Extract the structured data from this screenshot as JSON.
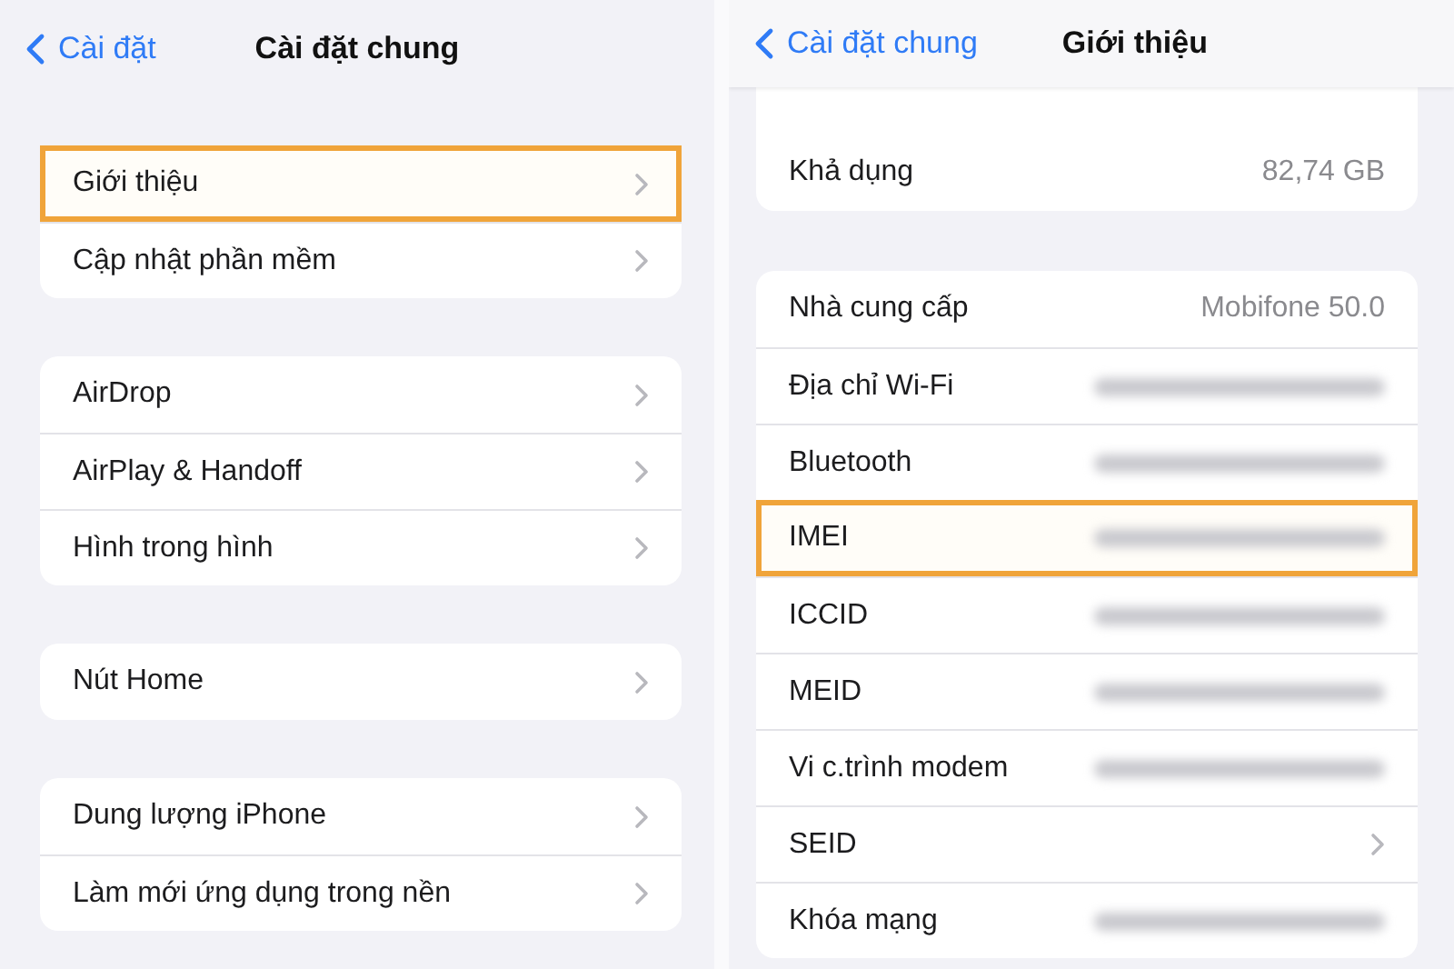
{
  "left_screen": {
    "back_button": "Cài đặt",
    "title": "Cài đặt chung",
    "groups": [
      {
        "rows": [
          {
            "label": "Giới thiệu",
            "highlighted": true
          },
          {
            "label": "Cập nhật phần mềm",
            "highlighted": false
          }
        ]
      },
      {
        "rows": [
          {
            "label": "AirDrop",
            "highlighted": false
          },
          {
            "label": "AirPlay & Handoff",
            "highlighted": false
          },
          {
            "label": "Hình trong hình",
            "highlighted": false
          }
        ]
      },
      {
        "rows": [
          {
            "label": "Nút Home",
            "highlighted": false
          }
        ]
      },
      {
        "rows": [
          {
            "label": "Dung lượng iPhone",
            "highlighted": false
          },
          {
            "label": "Làm mới ứng dụng trong nền",
            "highlighted": false
          }
        ]
      }
    ]
  },
  "right_screen": {
    "back_button": "Cài đặt chung",
    "title": "Giới thiệu",
    "groups": [
      {
        "rows": [
          {
            "label": "Khả dụng",
            "value": "82,74 GB",
            "blurred": false,
            "chevron": false,
            "highlighted": false
          }
        ]
      },
      {
        "rows": [
          {
            "label": "Nhà cung cấp",
            "value": "Mobifone 50.0",
            "blurred": false,
            "chevron": false,
            "highlighted": false
          },
          {
            "label": "Địa chỉ Wi-Fi",
            "blurred": true,
            "chevron": false,
            "highlighted": false
          },
          {
            "label": "Bluetooth",
            "blurred": true,
            "chevron": false,
            "highlighted": false
          },
          {
            "label": "IMEI",
            "blurred": true,
            "chevron": false,
            "highlighted": true
          },
          {
            "label": "ICCID",
            "blurred": true,
            "chevron": false,
            "highlighted": false
          },
          {
            "label": "MEID",
            "blurred": true,
            "chevron": false,
            "highlighted": false
          },
          {
            "label": "Vi c.trình modem",
            "blurred": true,
            "chevron": false,
            "highlighted": false
          },
          {
            "label": "SEID",
            "blurred": false,
            "chevron": true,
            "highlighted": false
          },
          {
            "label": "Khóa mạng",
            "blurred": true,
            "chevron": false,
            "highlighted": false
          }
        ]
      }
    ]
  }
}
